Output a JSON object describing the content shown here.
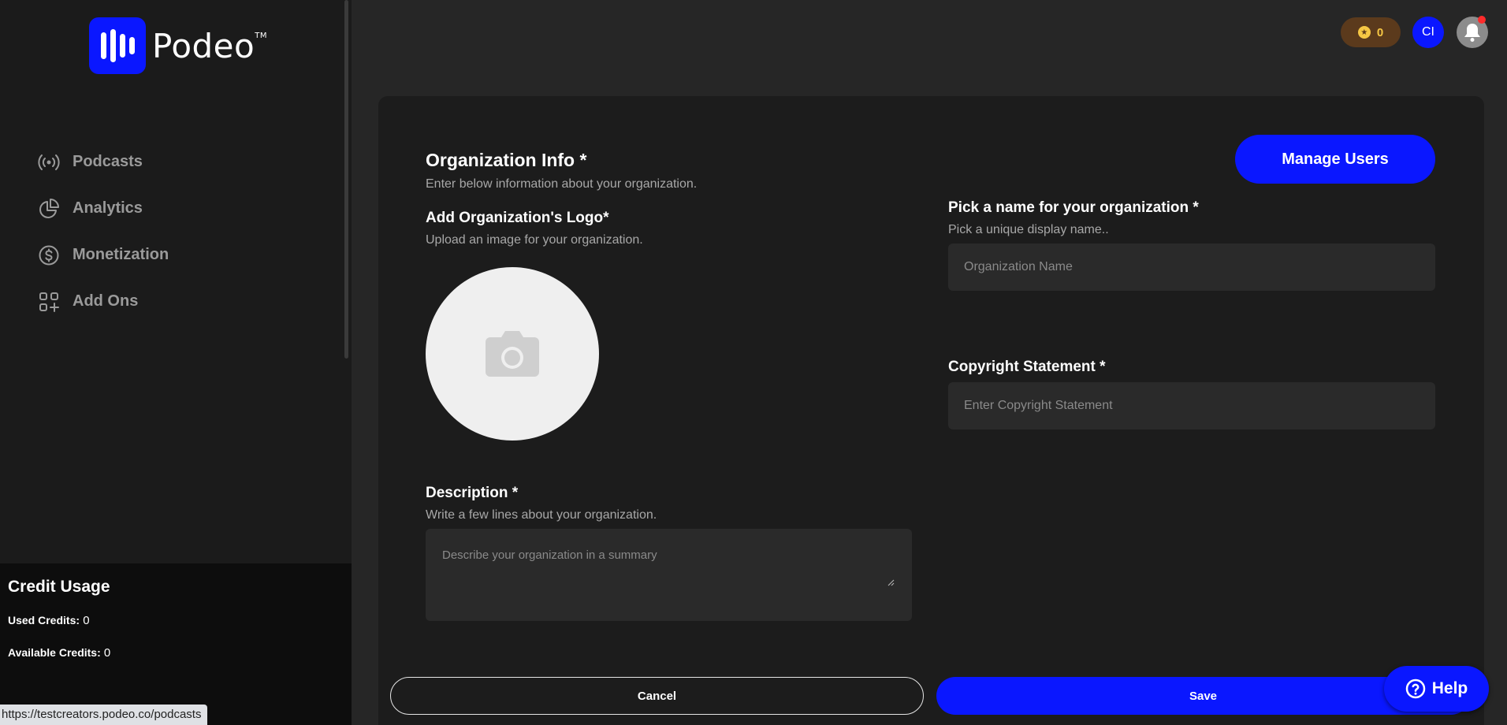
{
  "brand": {
    "name": "Podeo",
    "trademark": "TM"
  },
  "sidebar": {
    "items": [
      {
        "label": "Podcasts",
        "icon": "broadcast-icon"
      },
      {
        "label": "Analytics",
        "icon": "pie-chart-icon"
      },
      {
        "label": "Monetization",
        "icon": "dollar-icon"
      },
      {
        "label": "Add Ons",
        "icon": "grid-plus-icon"
      }
    ],
    "credit": {
      "title": "Credit Usage",
      "used_label": "Used Credits:",
      "used_value": "0",
      "available_label": "Available Credits:",
      "available_value": "0"
    }
  },
  "status_url": "https://testcreators.podeo.co/podcasts",
  "topbar": {
    "coins": "0",
    "avatar_initials": "CI"
  },
  "form": {
    "title": "Organization Info *",
    "subtitle": "Enter below information about your organization.",
    "manage_users": "Manage Users",
    "logo_label": "Add Organization's Logo*",
    "logo_sub": "Upload an image for your organization.",
    "name_label": "Pick a name for your organization *",
    "name_sub": "Pick a unique display name..",
    "name_placeholder": "Organization Name",
    "copyright_label": "Copyright Statement *",
    "copyright_placeholder": "Enter Copyright Statement",
    "description_label": "Description *",
    "description_sub": "Write a few lines about your organization.",
    "description_placeholder": "Describe your organization in a summary",
    "cancel": "Cancel",
    "save": "Save"
  },
  "help": "Help",
  "colors": {
    "accent": "#0a17ff",
    "background": "#262626",
    "sidebar": "#1b1b1b",
    "card": "#1c1c1c"
  }
}
